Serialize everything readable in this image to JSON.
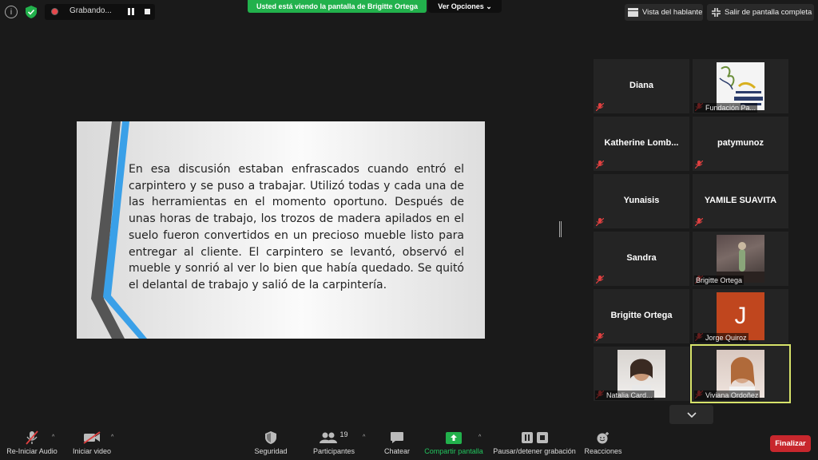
{
  "topbar": {
    "recording_label": "Grabando...",
    "viewing_banner": "Usted está viendo la pantalla de Brigitte Ortega",
    "view_options": "Ver Opciones",
    "speaker_view": "Vista del hablante",
    "exit_fullscreen": "Salir de pantalla completa"
  },
  "slide": {
    "text": "En esa discusión estaban enfrascados cuando entró el carpintero y se puso a trabajar. Utilizó todas y cada una de las herramientas en el momento oportuno. Después de unas horas de trabajo, los trozos de madera apilados en el suelo fueron convertidos en un precioso mueble listo para entregar al cliente. El carpintero se levantó, observó el mueble y sonrió al ver lo bien que había quedado. Se quitó el delantal de trabajo y salió de la carpintería."
  },
  "participants": [
    {
      "name": "Diana"
    },
    {
      "label": "Fundación Pa..."
    },
    {
      "name": "Katherine  Lomb..."
    },
    {
      "name": "patymunoz"
    },
    {
      "name": "Yunaisis"
    },
    {
      "name": "YAMILE SUAVITA"
    },
    {
      "name": "Sandra"
    },
    {
      "label": "Brigitte Ortega"
    },
    {
      "name": "Brigitte Ortega"
    },
    {
      "label": "Jorge Quiroz",
      "avatar_letter": "J"
    },
    {
      "label": "Natalia Card..."
    },
    {
      "label": "Viviana Ordoñez"
    }
  ],
  "toolbar": {
    "audio": "Re-Iniciar Audio",
    "video": "Iniciar video",
    "security": "Seguridad",
    "participants": "Participantes",
    "participants_count": "19",
    "chat": "Chatear",
    "share": "Compartir pantalla",
    "pause_rec": "Pausar/detener grabación",
    "reactions": "Reacciones",
    "end": "Finalizar"
  },
  "colors": {
    "banner_green": "#22b14c",
    "end_red": "#c8272d",
    "active_speaker_outline": "#d7e36a",
    "muted_red": "#e04040"
  }
}
